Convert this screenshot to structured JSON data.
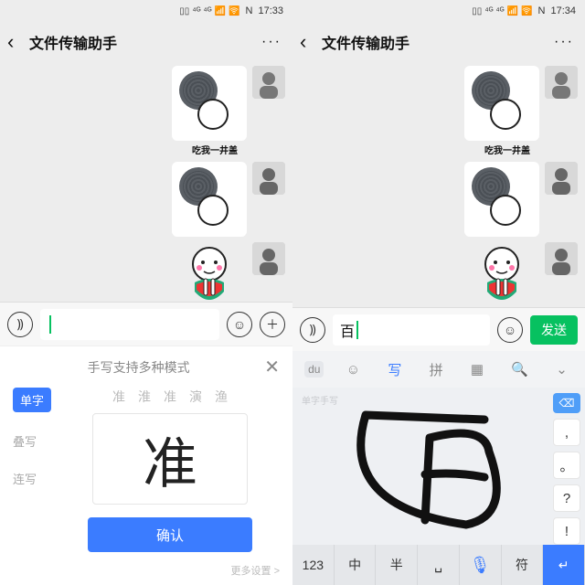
{
  "left": {
    "status": {
      "time": "17:33",
      "nfc": "N",
      "signals": "⁴ᴳ ⁴ᴳ"
    },
    "header": {
      "title": "文件传输助手"
    },
    "chat": {
      "caption2": "吃我一井盖"
    },
    "input": {
      "value": ""
    },
    "ime": {
      "hint": "手写支持多种模式",
      "modes": {
        "single": "单字",
        "stack": "叠写",
        "cont": "连写"
      },
      "candidates": [
        "准",
        "淮",
        "准",
        "演",
        "渔"
      ],
      "handwritten": "准",
      "confirm": "确认",
      "more": "更多设置 >"
    }
  },
  "right": {
    "status": {
      "time": "17:34",
      "nfc": "N",
      "signals": "⁴ᴳ ⁴ᴳ"
    },
    "header": {
      "title": "文件传输助手"
    },
    "chat": {
      "caption2": "吃我一井盖"
    },
    "input": {
      "value": "百",
      "send": "发送"
    },
    "ime": {
      "tabs": {
        "logo": "du",
        "write": "写",
        "pinyin": "拼"
      },
      "area_hint": "单字手写",
      "puncts": [
        ",",
        "。",
        "?",
        "!"
      ],
      "bottom": {
        "num": "123",
        "zh": "中",
        "half": "半",
        "sym": "符",
        "enter": "↵"
      }
    }
  }
}
